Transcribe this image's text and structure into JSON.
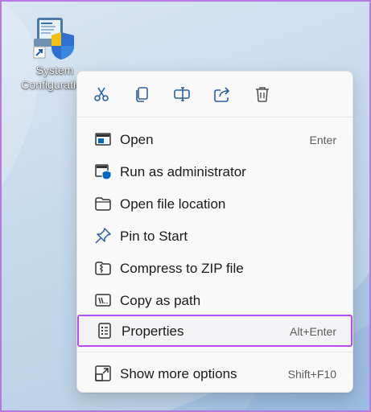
{
  "desktop": {
    "shortcut_icon": {
      "name": "system-configuration-icon",
      "label_line1": "System",
      "label_line2": "Configuration"
    }
  },
  "context_menu": {
    "quick_actions": [
      {
        "name": "cut",
        "icon": "scissors-icon"
      },
      {
        "name": "copy",
        "icon": "copy-icon"
      },
      {
        "name": "rename",
        "icon": "rename-icon"
      },
      {
        "name": "share",
        "icon": "share-icon"
      },
      {
        "name": "delete",
        "icon": "trash-icon"
      }
    ],
    "items": [
      {
        "label": "Open",
        "shortcut": "Enter",
        "icon": "open-window-icon"
      },
      {
        "label": "Run as administrator",
        "shortcut": "",
        "icon": "shield-admin-icon"
      },
      {
        "label": "Open file location",
        "shortcut": "",
        "icon": "folder-icon"
      },
      {
        "label": "Pin to Start",
        "shortcut": "",
        "icon": "pin-icon"
      },
      {
        "label": "Compress to ZIP file",
        "shortcut": "",
        "icon": "zip-folder-icon"
      },
      {
        "label": "Copy as path",
        "shortcut": "",
        "icon": "path-icon"
      },
      {
        "label": "Properties",
        "shortcut": "Alt+Enter",
        "icon": "properties-icon",
        "highlighted": true
      }
    ],
    "more_options": {
      "label": "Show more options",
      "shortcut": "Shift+F10",
      "icon": "more-options-icon"
    }
  },
  "colors": {
    "highlight_border": "#b84cf0",
    "accent_blue": "#0067c0",
    "menu_background": "#f9f9f9"
  }
}
